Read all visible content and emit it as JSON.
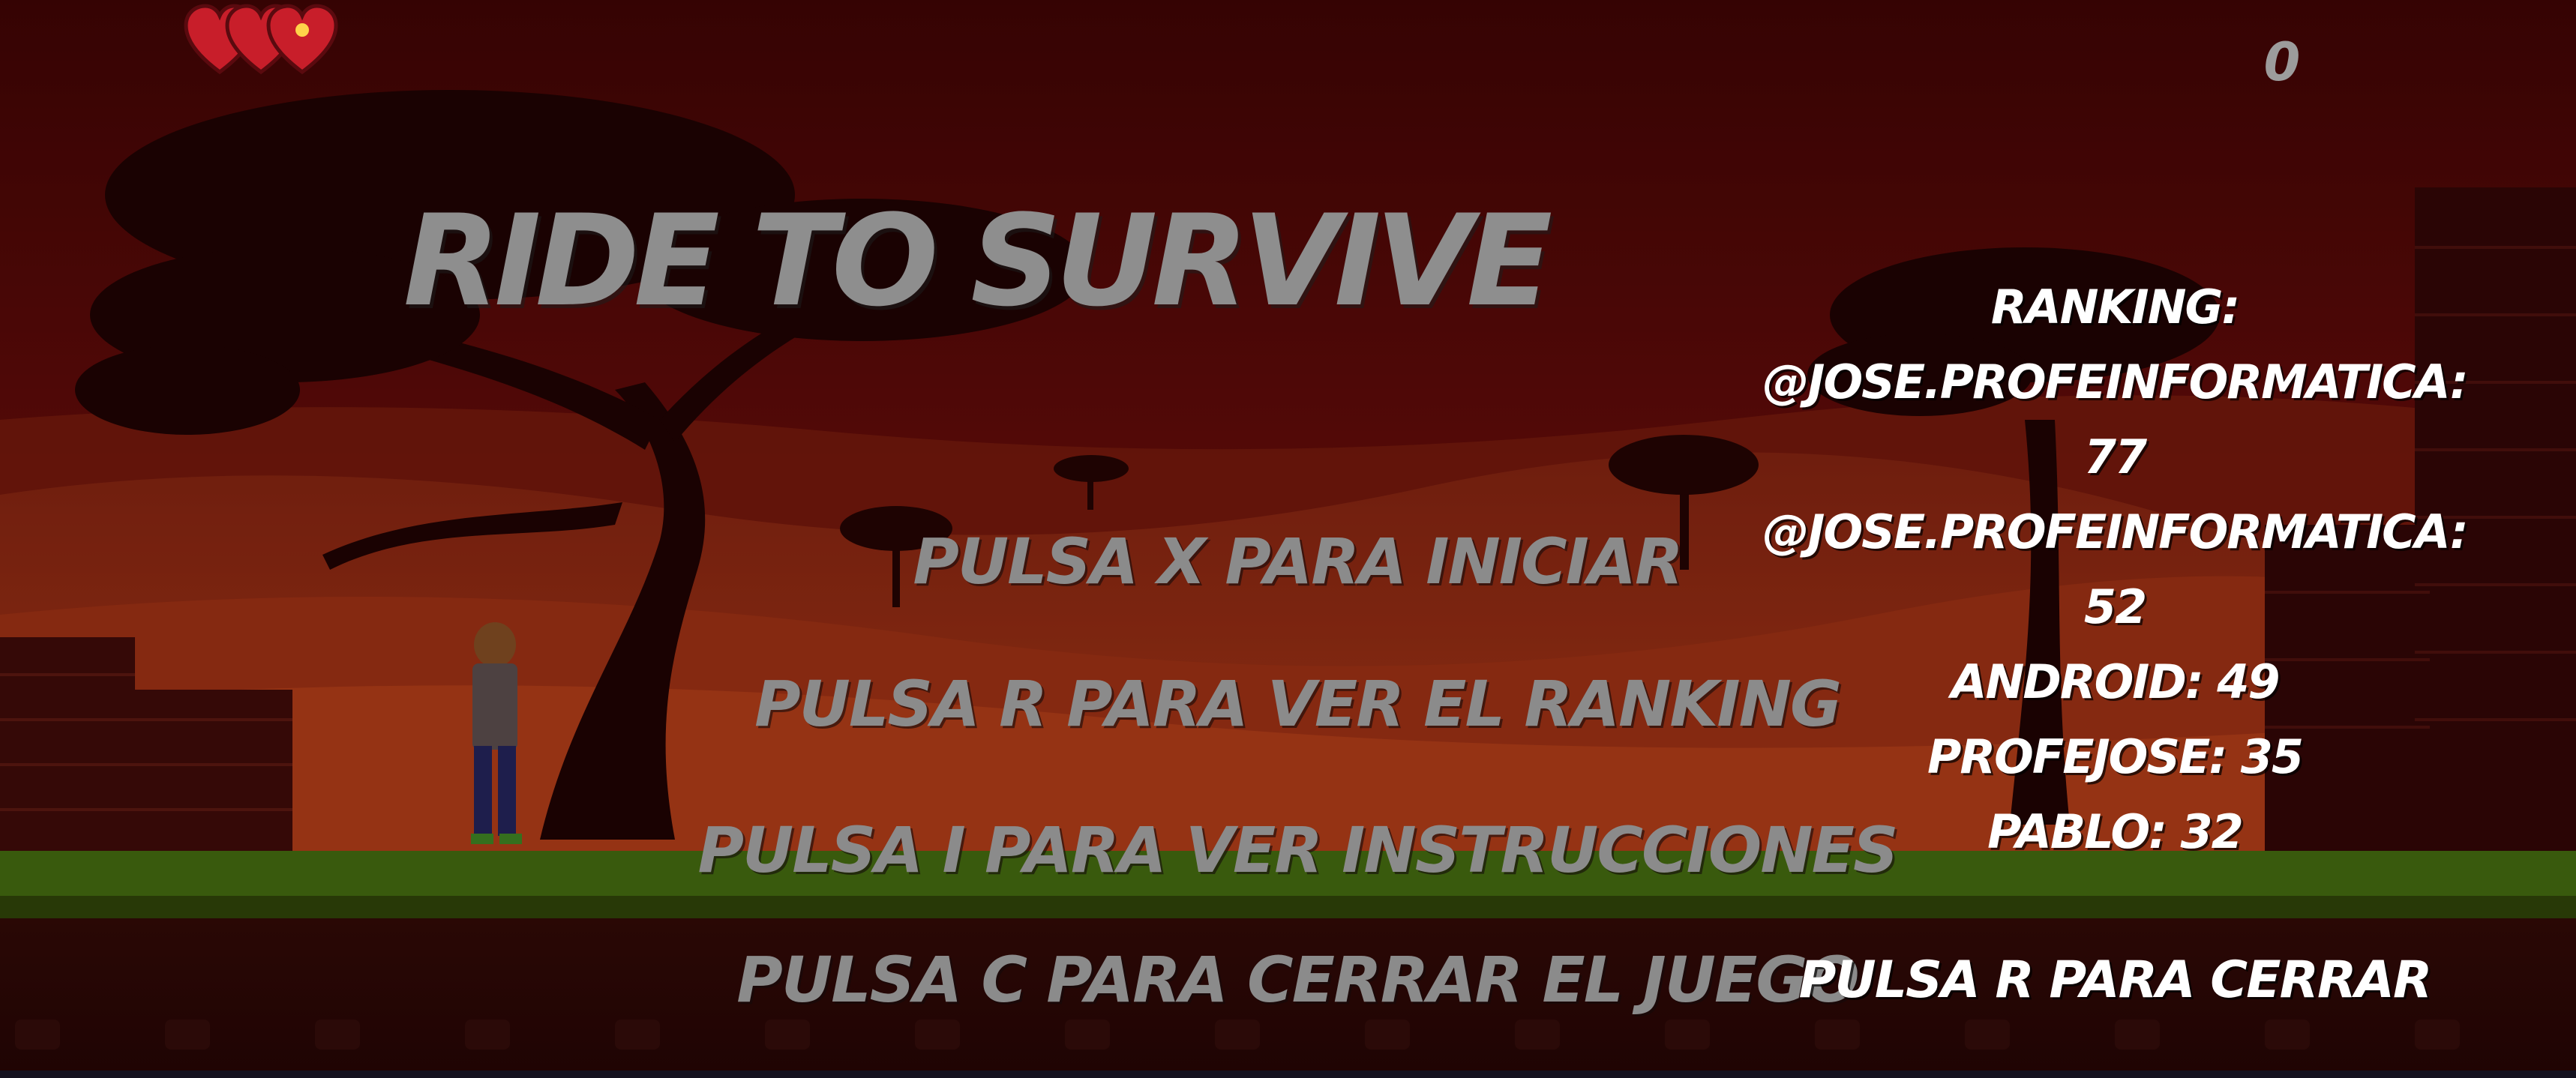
{
  "hud": {
    "lives": 3,
    "score": "0",
    "heart_color": "#c81e2a"
  },
  "title": "RIDE TO SURVIVE",
  "menu": {
    "start": "PULSA X PARA INICIAR",
    "ranking": "PULSA R PARA VER EL RANKING",
    "instructions": "PULSA I PARA VER INSTRUCCIONES",
    "close": "PULSA C PARA CERRAR EL JUEGO"
  },
  "ranking": {
    "heading": "RANKING:",
    "rows": [
      "@JOSE.PROFEINFORMATICA:",
      "77",
      "@JOSE.PROFEINFORMATICA:",
      "52",
      "ANDROID: 49",
      "PROFEJOSE: 35",
      "PABLO: 32"
    ],
    "close_hint": "PULSA R PARA CERRAR"
  },
  "colors": {
    "sky": "#5a0b0b",
    "dunes": "#b9401c",
    "grass": "#3f7d12",
    "menu_text": "#8b8b8b",
    "ranking_text": "#ffffff"
  }
}
